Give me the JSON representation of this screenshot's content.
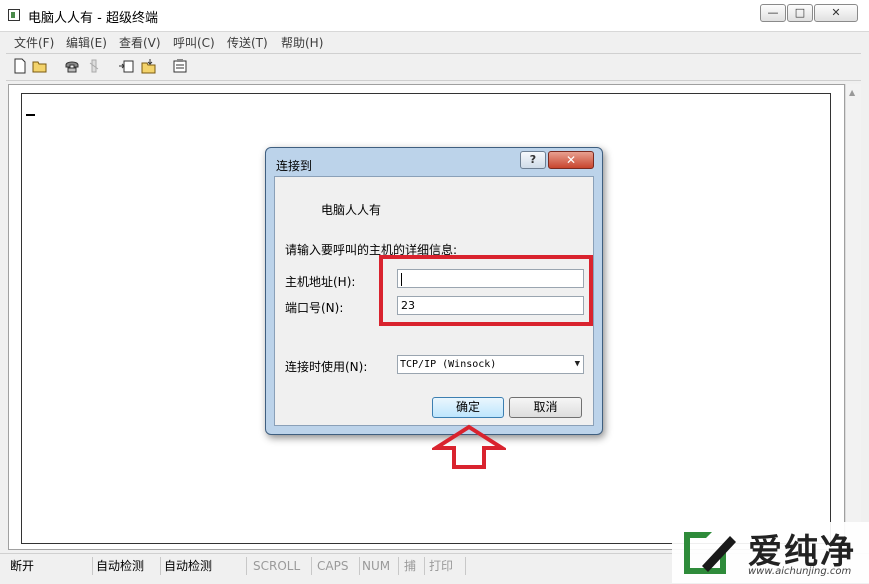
{
  "window": {
    "title": "电脑人人有 - 超级终端",
    "caption_buttons": {
      "minimize": "—",
      "maximize": "□",
      "close": "✕"
    }
  },
  "menu": [
    "文件(F)",
    "编辑(E)",
    "查看(V)",
    "呼叫(C)",
    "传送(T)",
    "帮助(H)"
  ],
  "toolbar": [
    "new-icon",
    "open-icon",
    "call-icon",
    "disconnect-icon",
    "send-icon",
    "receive-icon",
    "properties-icon"
  ],
  "statusbar": {
    "state": "断开",
    "detect1": "自动检测",
    "detect2": "自动检测",
    "scroll": "SCROLL",
    "caps": "CAPS",
    "num": "NUM",
    "capture": "捕",
    "print": "打印"
  },
  "dialog": {
    "title": "连接到",
    "help": "?",
    "close": "✕",
    "connection_name": "电脑人人有",
    "prompt": "请输入要呼叫的主机的详细信息:",
    "host_label": "主机地址(H):",
    "host_value": "",
    "port_label": "端口号(N):",
    "port_value": "23",
    "connect_using_label": "连接时使用(N):",
    "connect_using_value": "TCP/IP (Winsock)",
    "ok": "确定",
    "cancel": "取消"
  },
  "watermark": {
    "text": "爱纯净",
    "url": "www.aichunjing.com"
  },
  "colors": {
    "highlight": "#d9232e",
    "arrow": "#d9232e"
  }
}
